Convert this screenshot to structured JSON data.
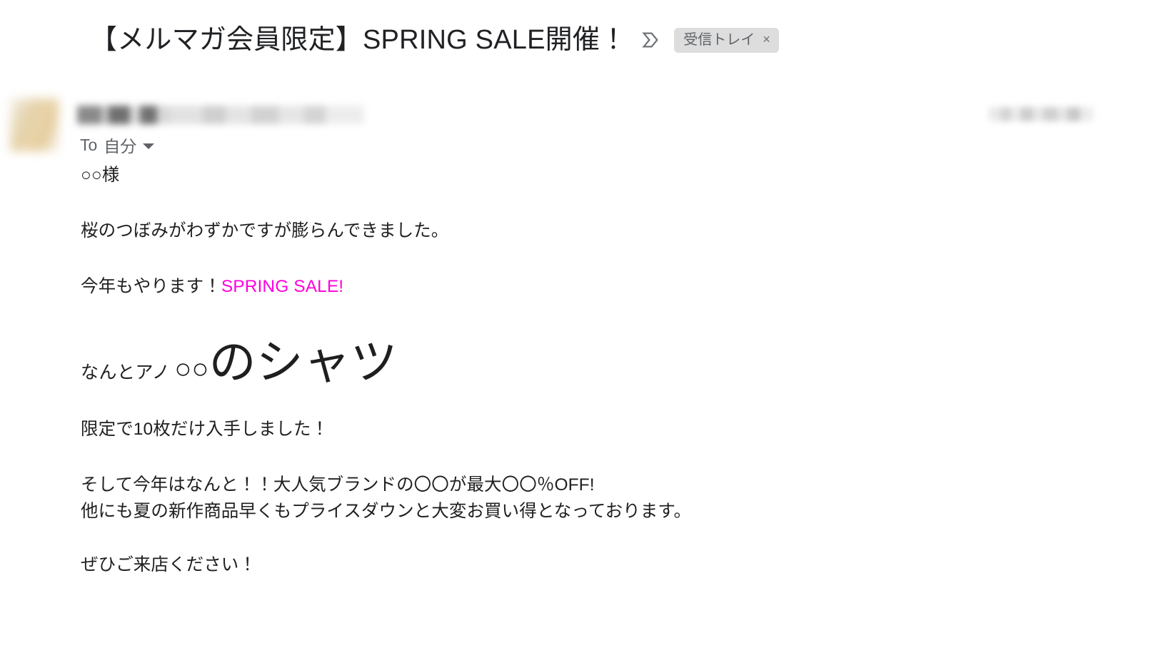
{
  "email": {
    "subject": "【メルマガ会員限定】SPRING SALE開催！",
    "important_marker_icon": "important-chevron-icon",
    "label_chip": {
      "text": "受信トレイ",
      "close": "×",
      "background": "#ddddde",
      "text_color": "#5f6368"
    },
    "sender": {
      "avatar_icon": "avatar-image",
      "name_redacted": true,
      "timestamp_redacted": true
    },
    "recipient": {
      "prefix": "To",
      "value": "自分",
      "caret_icon": "chevron-down-icon"
    },
    "body": {
      "salutation": "○○様",
      "paragraph_1": "桜のつぼみがわずかですが膨らんできました。",
      "announce_prefix": "今年もやります！",
      "announce_accent": "SPRING SALE!",
      "announce_accent_color": "#ff00dd",
      "headline_small": "なんとアノ",
      "headline_mid": "○○",
      "headline_big": "のシャツ",
      "paragraph_2": "限定で10枚だけ入手しました！",
      "paragraph_3_line_1": "そして今年はなんと！！大人気ブランドの〇〇が最大〇〇％OFF!",
      "paragraph_3_line_2": "他にも夏の新作商品早くもプライスダウンと大変お買い得となっております。",
      "paragraph_4": "ぜひご来店ください！"
    }
  }
}
